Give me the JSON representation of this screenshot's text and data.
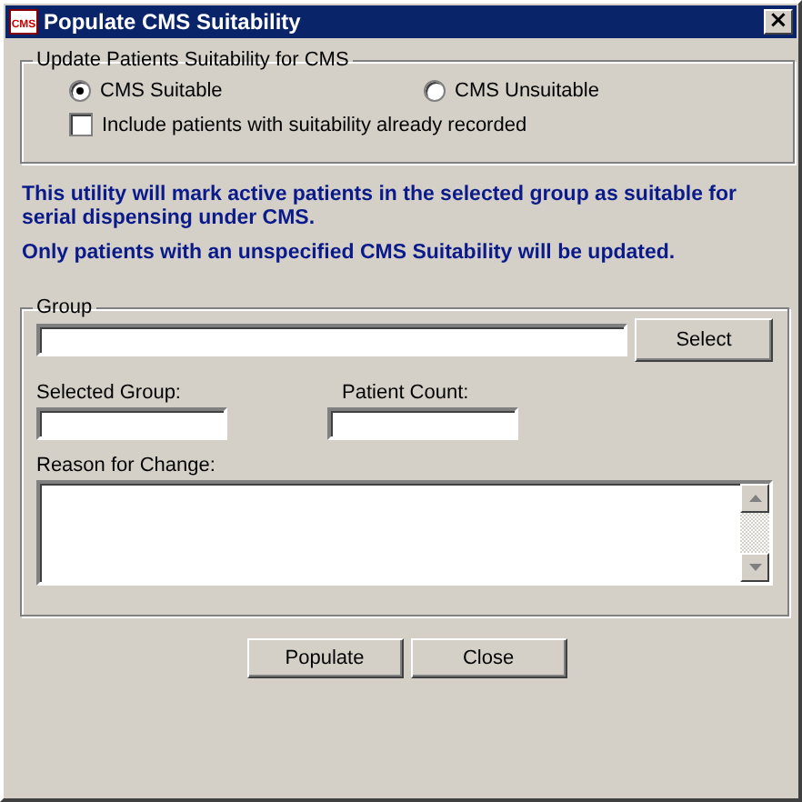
{
  "window": {
    "title": "Populate CMS Suitability",
    "icon_text": "CMS",
    "close": "×"
  },
  "suitability": {
    "legend": "Update Patients Suitability for CMS",
    "options": [
      {
        "label": "CMS Suitable",
        "selected": true
      },
      {
        "label": "CMS Unsuitable",
        "selected": false
      }
    ],
    "include_recorded": {
      "label": "Include patients with suitability already recorded",
      "checked": false
    }
  },
  "notes": [
    "This utility will mark active patients in the selected group as suitable for serial dispensing under CMS.",
    "Only patients with an unspecified CMS Suitability will be updated."
  ],
  "group": {
    "legend": "Group",
    "select_button": "Select",
    "selected_group_label": "Selected Group:",
    "patient_count_label": "Patient Count:",
    "reason_label": "Reason for Change:"
  },
  "buttons": [
    "Populate",
    "Close"
  ]
}
